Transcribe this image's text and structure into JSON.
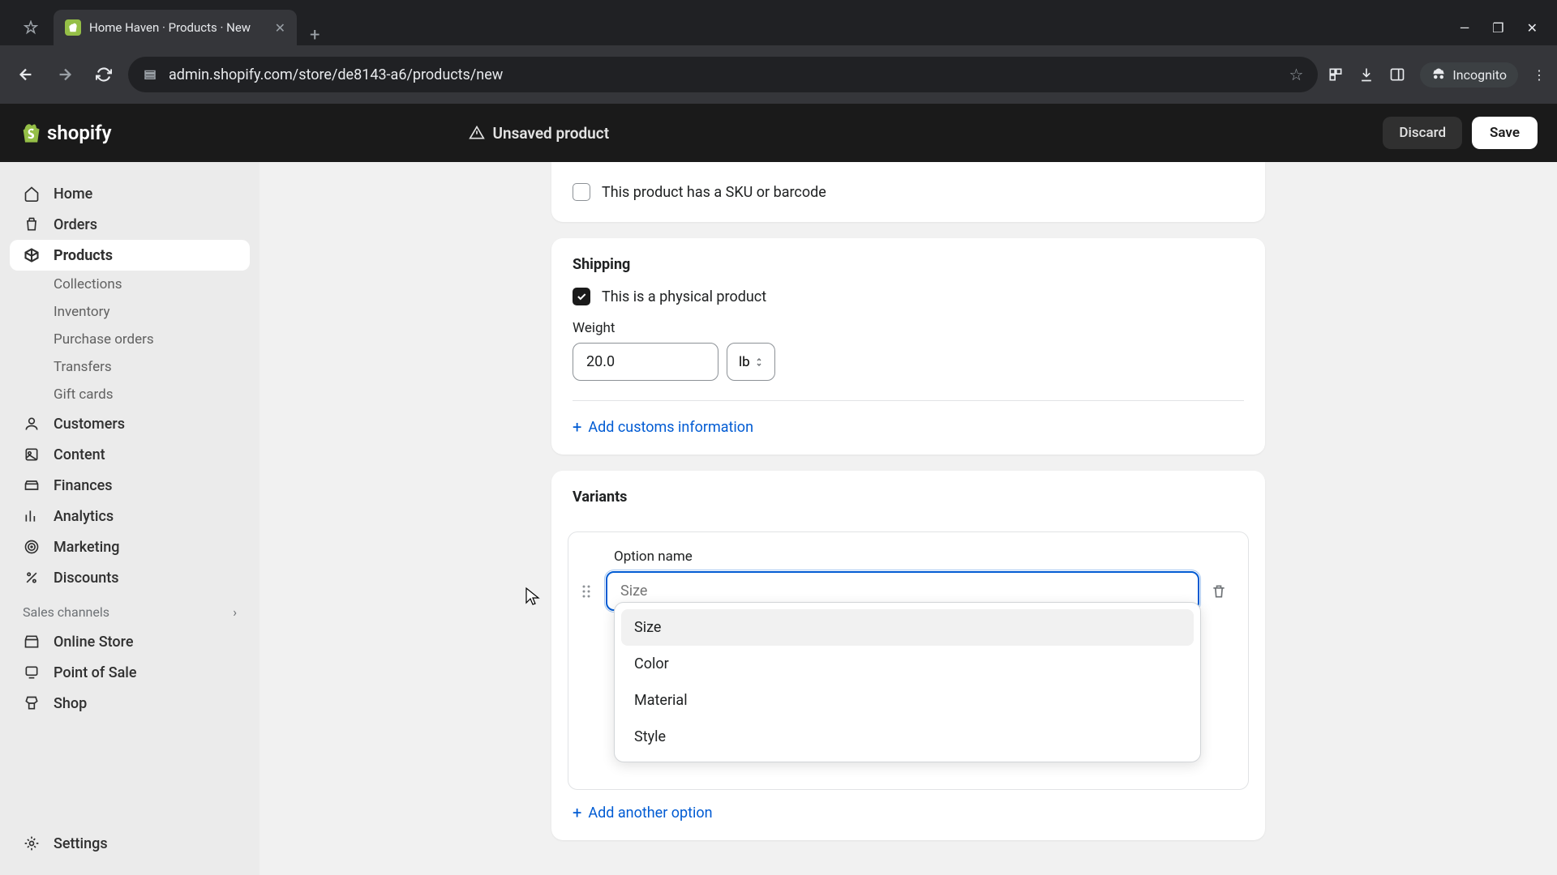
{
  "browser": {
    "tab_title": "Home Haven · Products · New ",
    "url": "admin.shopify.com/store/de8143-a6/products/new",
    "incognito_label": "Incognito"
  },
  "topbar": {
    "logo_text": "shopify",
    "unsaved_label": "Unsaved product",
    "discard_label": "Discard",
    "save_label": "Save"
  },
  "sidebar": {
    "items": [
      {
        "label": "Home"
      },
      {
        "label": "Orders"
      },
      {
        "label": "Products"
      },
      {
        "label": "Customers"
      },
      {
        "label": "Content"
      },
      {
        "label": "Finances"
      },
      {
        "label": "Analytics"
      },
      {
        "label": "Marketing"
      },
      {
        "label": "Discounts"
      }
    ],
    "product_subs": [
      "Collections",
      "Inventory",
      "Purchase orders",
      "Transfers",
      "Gift cards"
    ],
    "section_label": "Sales channels",
    "channels": [
      "Online Store",
      "Point of Sale",
      "Shop"
    ],
    "settings_label": "Settings"
  },
  "inventory": {
    "sku_label": "This product has a SKU or barcode"
  },
  "shipping": {
    "title": "Shipping",
    "physical_label": "This is a physical product",
    "weight_label": "Weight",
    "weight_value": "20.0",
    "weight_unit": "lb",
    "customs_label": "Add customs information"
  },
  "variants": {
    "title": "Variants",
    "option_name_label": "Option name",
    "option_placeholder": "Size",
    "dropdown": [
      "Size",
      "Color",
      "Material",
      "Style"
    ],
    "add_another_label": "Add another option"
  }
}
